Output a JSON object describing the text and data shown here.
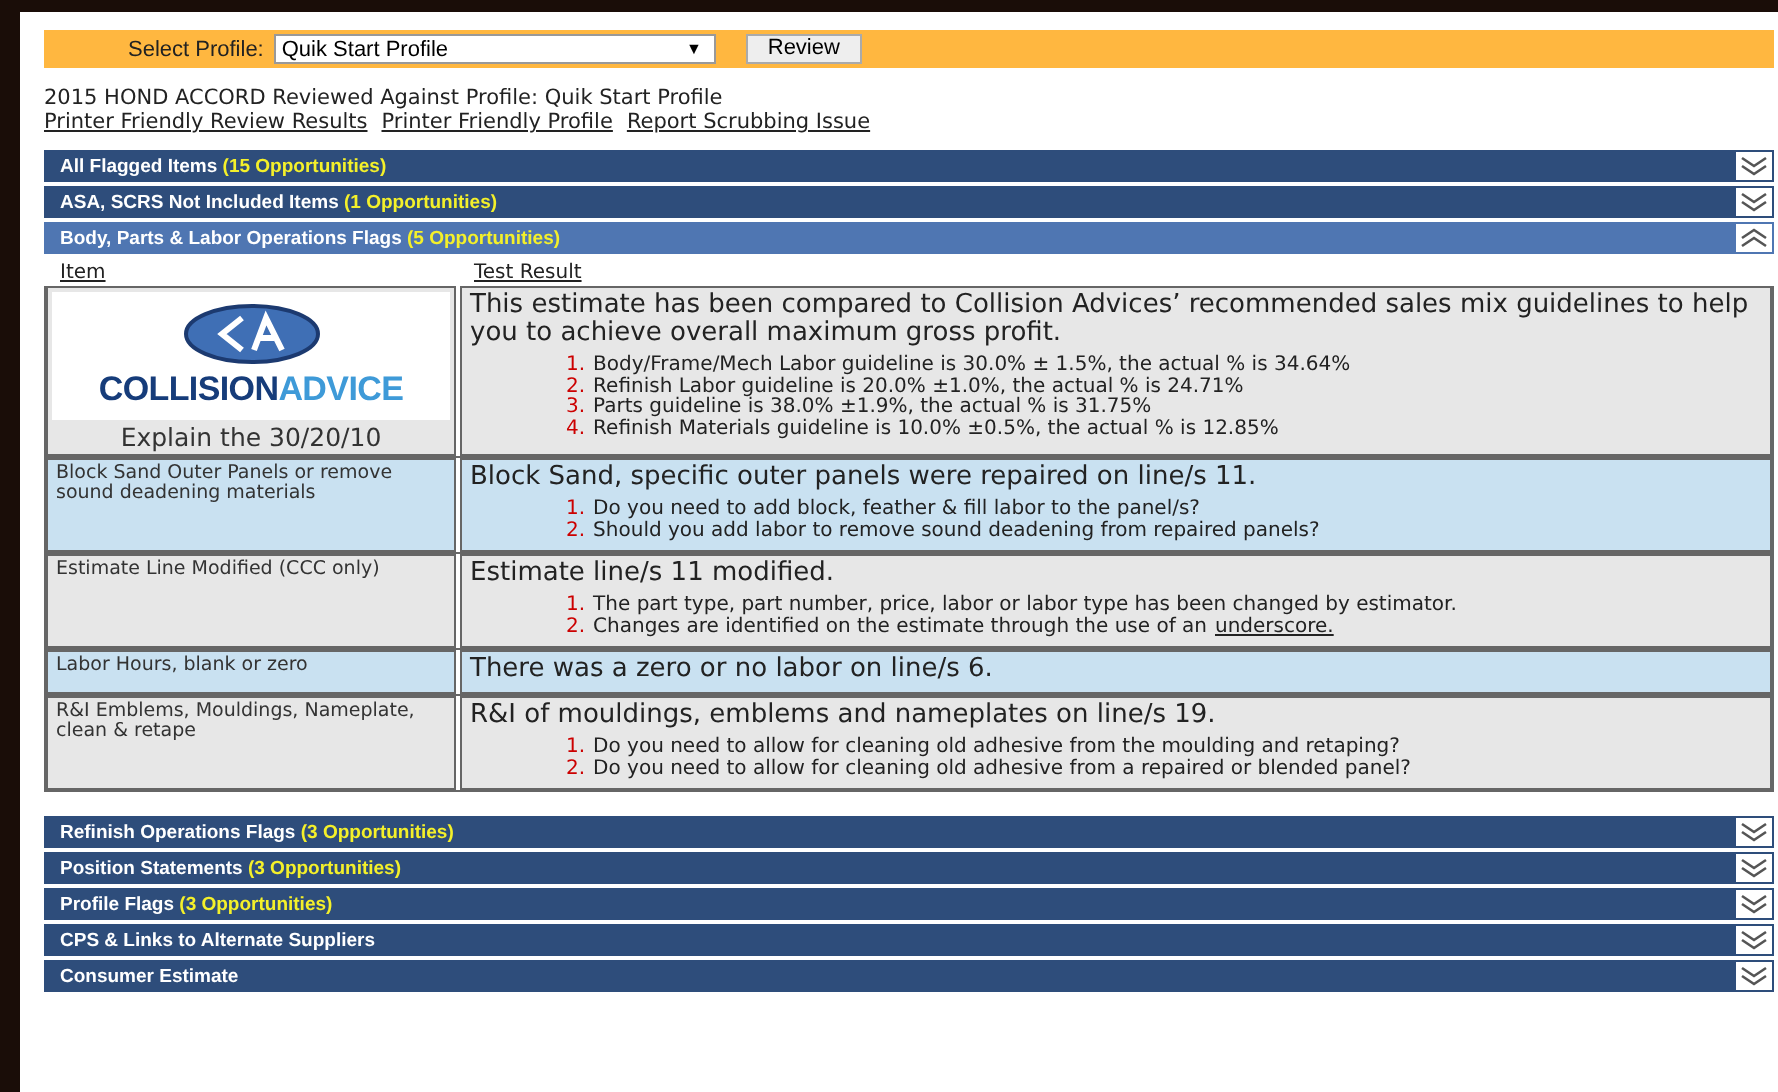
{
  "profile_bar": {
    "label": "Select Profile:",
    "select_value": "Quik Start Profile",
    "select_caret": "▼",
    "button": "Review"
  },
  "heading": "2015 HOND ACCORD Reviewed Against Profile: Quik Start Profile",
  "links": [
    "Printer Friendly Review Results",
    "Printer Friendly Profile",
    "Report Scrubbing Issue"
  ],
  "sections": [
    {
      "title": "All Flagged Items",
      "count": "(15 Opportunities)",
      "expanded": false
    },
    {
      "title": "ASA, SCRS Not Included Items",
      "count": "(1 Opportunities)",
      "expanded": false
    },
    {
      "title": "Body, Parts & Labor Operations Flags",
      "count": "(5 Opportunities)",
      "expanded": true,
      "table": {
        "columns": [
          "Item",
          "Test Result"
        ],
        "rows": [
          {
            "kind": "logo",
            "logo": {
              "word1": "COLLISION",
              "word2": "ADVICE"
            },
            "link": "Explain the 30/20/10",
            "result": "This estimate has been compared to Collision Advices’ recommended sales mix guidelines to help you to achieve overall maximum gross profit.",
            "points": [
              {
                "number": "1.",
                "text": "Body/Frame/Mech Labor guideline is 30.0% ± 1.5%, the actual % is 34.64%"
              },
              {
                "number": "2.",
                "text": "Refinish Labor guideline is 20.0% ±1.0%, the actual % is 24.71%"
              },
              {
                "number": "3.",
                "text": "Parts guideline is 38.0% ±1.9%, the actual % is 31.75%"
              },
              {
                "number": "4.",
                "text": "Refinish Materials guideline is 10.0% ±0.5%, the actual % is 12.85%"
              }
            ]
          },
          {
            "kind": "text",
            "item": "Block Sand Outer Panels or remove sound deadening materials",
            "result": "Block Sand, specific outer panels were repaired on line/s  11.",
            "points": [
              {
                "number": "1.",
                "text": "Do you need to add block, feather & fill labor to the panel/s?"
              },
              {
                "number": "2.",
                "text": "Should you add labor to remove sound deadening from repaired panels?"
              }
            ]
          },
          {
            "kind": "text",
            "item": "Estimate Line Modified (CCC only)",
            "result": "Estimate line/s  11 modified.",
            "points": [
              {
                "number": "1.",
                "text": "The part type, part number, price, labor or labor type has been changed by estimator."
              },
              {
                "number": "2.",
                "text": "Changes are identified on the estimate through the use of an",
                "link": "underscore."
              }
            ]
          },
          {
            "kind": "text",
            "item": "Labor Hours, blank or zero",
            "result": "There was a zero or no labor on line/s  6."
          },
          {
            "kind": "text",
            "item": "R&I Emblems, Mouldings, Nameplate, clean & retape",
            "result": "R&I of mouldings, emblems and nameplates on line/s  19.",
            "points": [
              {
                "number": "1.",
                "text": "Do you need to allow for cleaning old adhesive from the moulding and retaping?"
              },
              {
                "number": "2.",
                "text": "Do you need to allow for cleaning old adhesive from a repaired or blended panel?"
              }
            ]
          }
        ]
      }
    },
    {
      "title": "Refinish Operations Flags",
      "count": "(3 Opportunities)",
      "expanded": false
    },
    {
      "title": "Position Statements",
      "count": "(3 Opportunities)",
      "expanded": false
    },
    {
      "title": "Profile Flags",
      "count": "(3 Opportunities)",
      "expanded": false
    },
    {
      "title": "CPS & Links to Alternate Suppliers",
      "expanded": false
    },
    {
      "title": "Consumer Estimate",
      "expanded": false
    }
  ]
}
